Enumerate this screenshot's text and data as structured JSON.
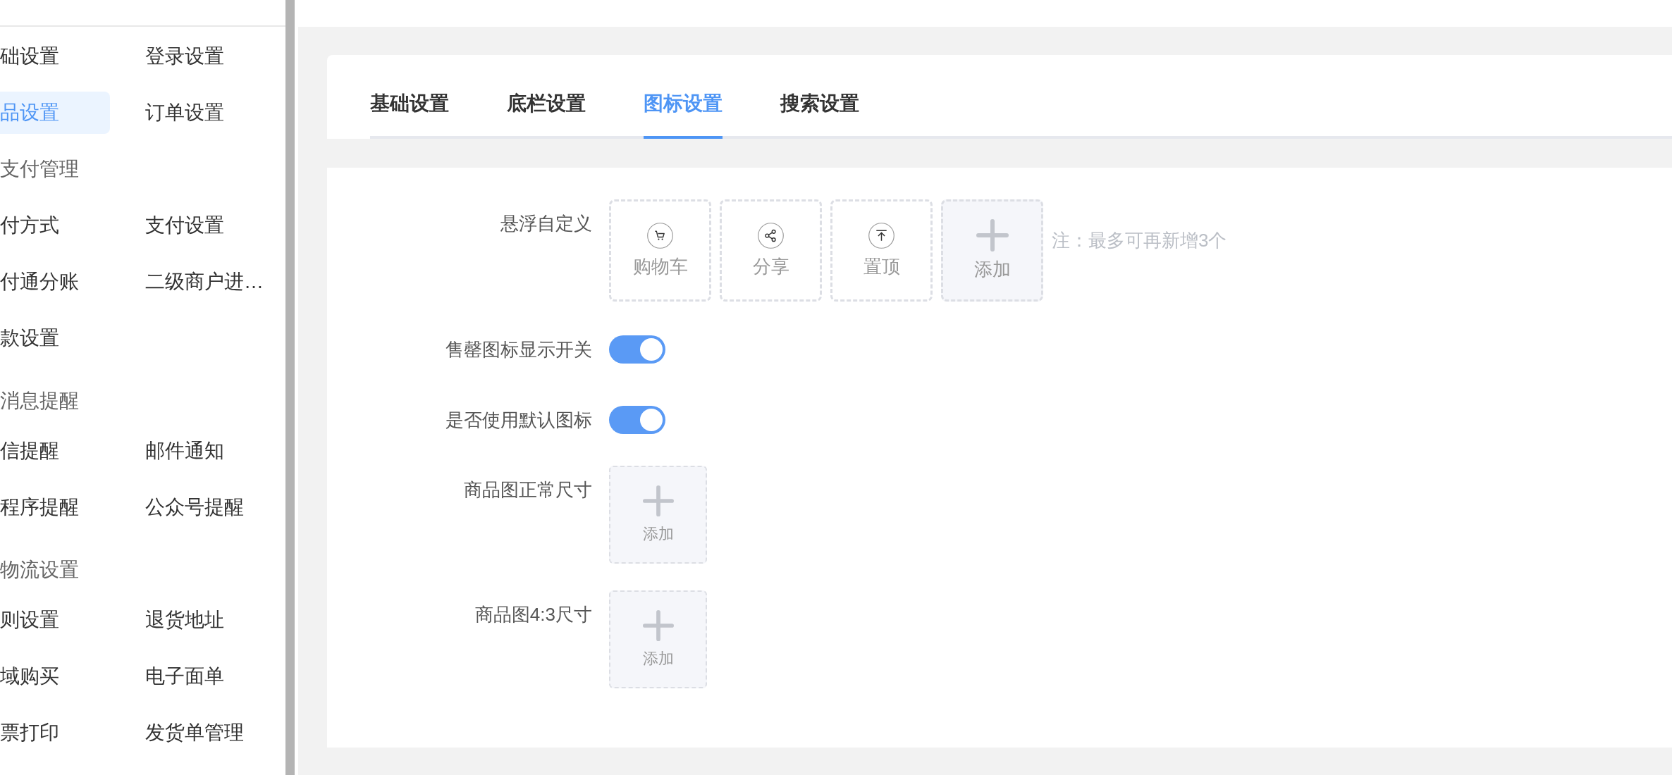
{
  "sidebar": {
    "groups": [
      {
        "items": [
          {
            "label": "础设置",
            "selected": false
          },
          {
            "label": "登录设置",
            "selected": false
          },
          {
            "label": "品设置",
            "selected": true
          },
          {
            "label": "订单设置",
            "selected": false
          }
        ]
      },
      {
        "title": "支付管理",
        "items": [
          {
            "label": "付方式",
            "selected": false
          },
          {
            "label": "支付设置",
            "selected": false
          },
          {
            "label": "付通分账",
            "selected": false
          },
          {
            "label": "二级商户进…",
            "selected": false
          },
          {
            "label": "款设置",
            "selected": false
          }
        ]
      },
      {
        "title": "消息提醒",
        "items": [
          {
            "label": "信提醒",
            "selected": false
          },
          {
            "label": "邮件通知",
            "selected": false
          },
          {
            "label": "程序提醒",
            "selected": false
          },
          {
            "label": "公众号提醒",
            "selected": false
          }
        ]
      },
      {
        "title": "物流设置",
        "items": [
          {
            "label": "则设置",
            "selected": false
          },
          {
            "label": "退货地址",
            "selected": false
          },
          {
            "label": "域购买",
            "selected": false
          },
          {
            "label": "电子面单",
            "selected": false
          },
          {
            "label": "票打印",
            "selected": false
          },
          {
            "label": "发货单管理",
            "selected": false
          }
        ]
      }
    ]
  },
  "tabs": [
    {
      "label": "基础设置",
      "selected": false
    },
    {
      "label": "底栏设置",
      "selected": false
    },
    {
      "label": "图标设置",
      "selected": true
    },
    {
      "label": "搜索设置",
      "selected": false
    }
  ],
  "form": {
    "rows": [
      {
        "kind": "icon-picker",
        "label": "悬浮自定义",
        "icons": [
          {
            "label": "购物车"
          },
          {
            "label": "分享"
          },
          {
            "label": "置顶"
          }
        ],
        "add_label": "添加",
        "note": "注：最多可再新增3个"
      },
      {
        "kind": "switch",
        "label": "售罄图标显示开关",
        "on": true
      },
      {
        "kind": "switch",
        "label": "是否使用默认图标",
        "on": true
      },
      {
        "kind": "upload",
        "label": "商品图正常尺寸",
        "add_label": "添加"
      },
      {
        "kind": "upload",
        "label": "商品图4:3尺寸",
        "add_label": "添加"
      }
    ]
  }
}
